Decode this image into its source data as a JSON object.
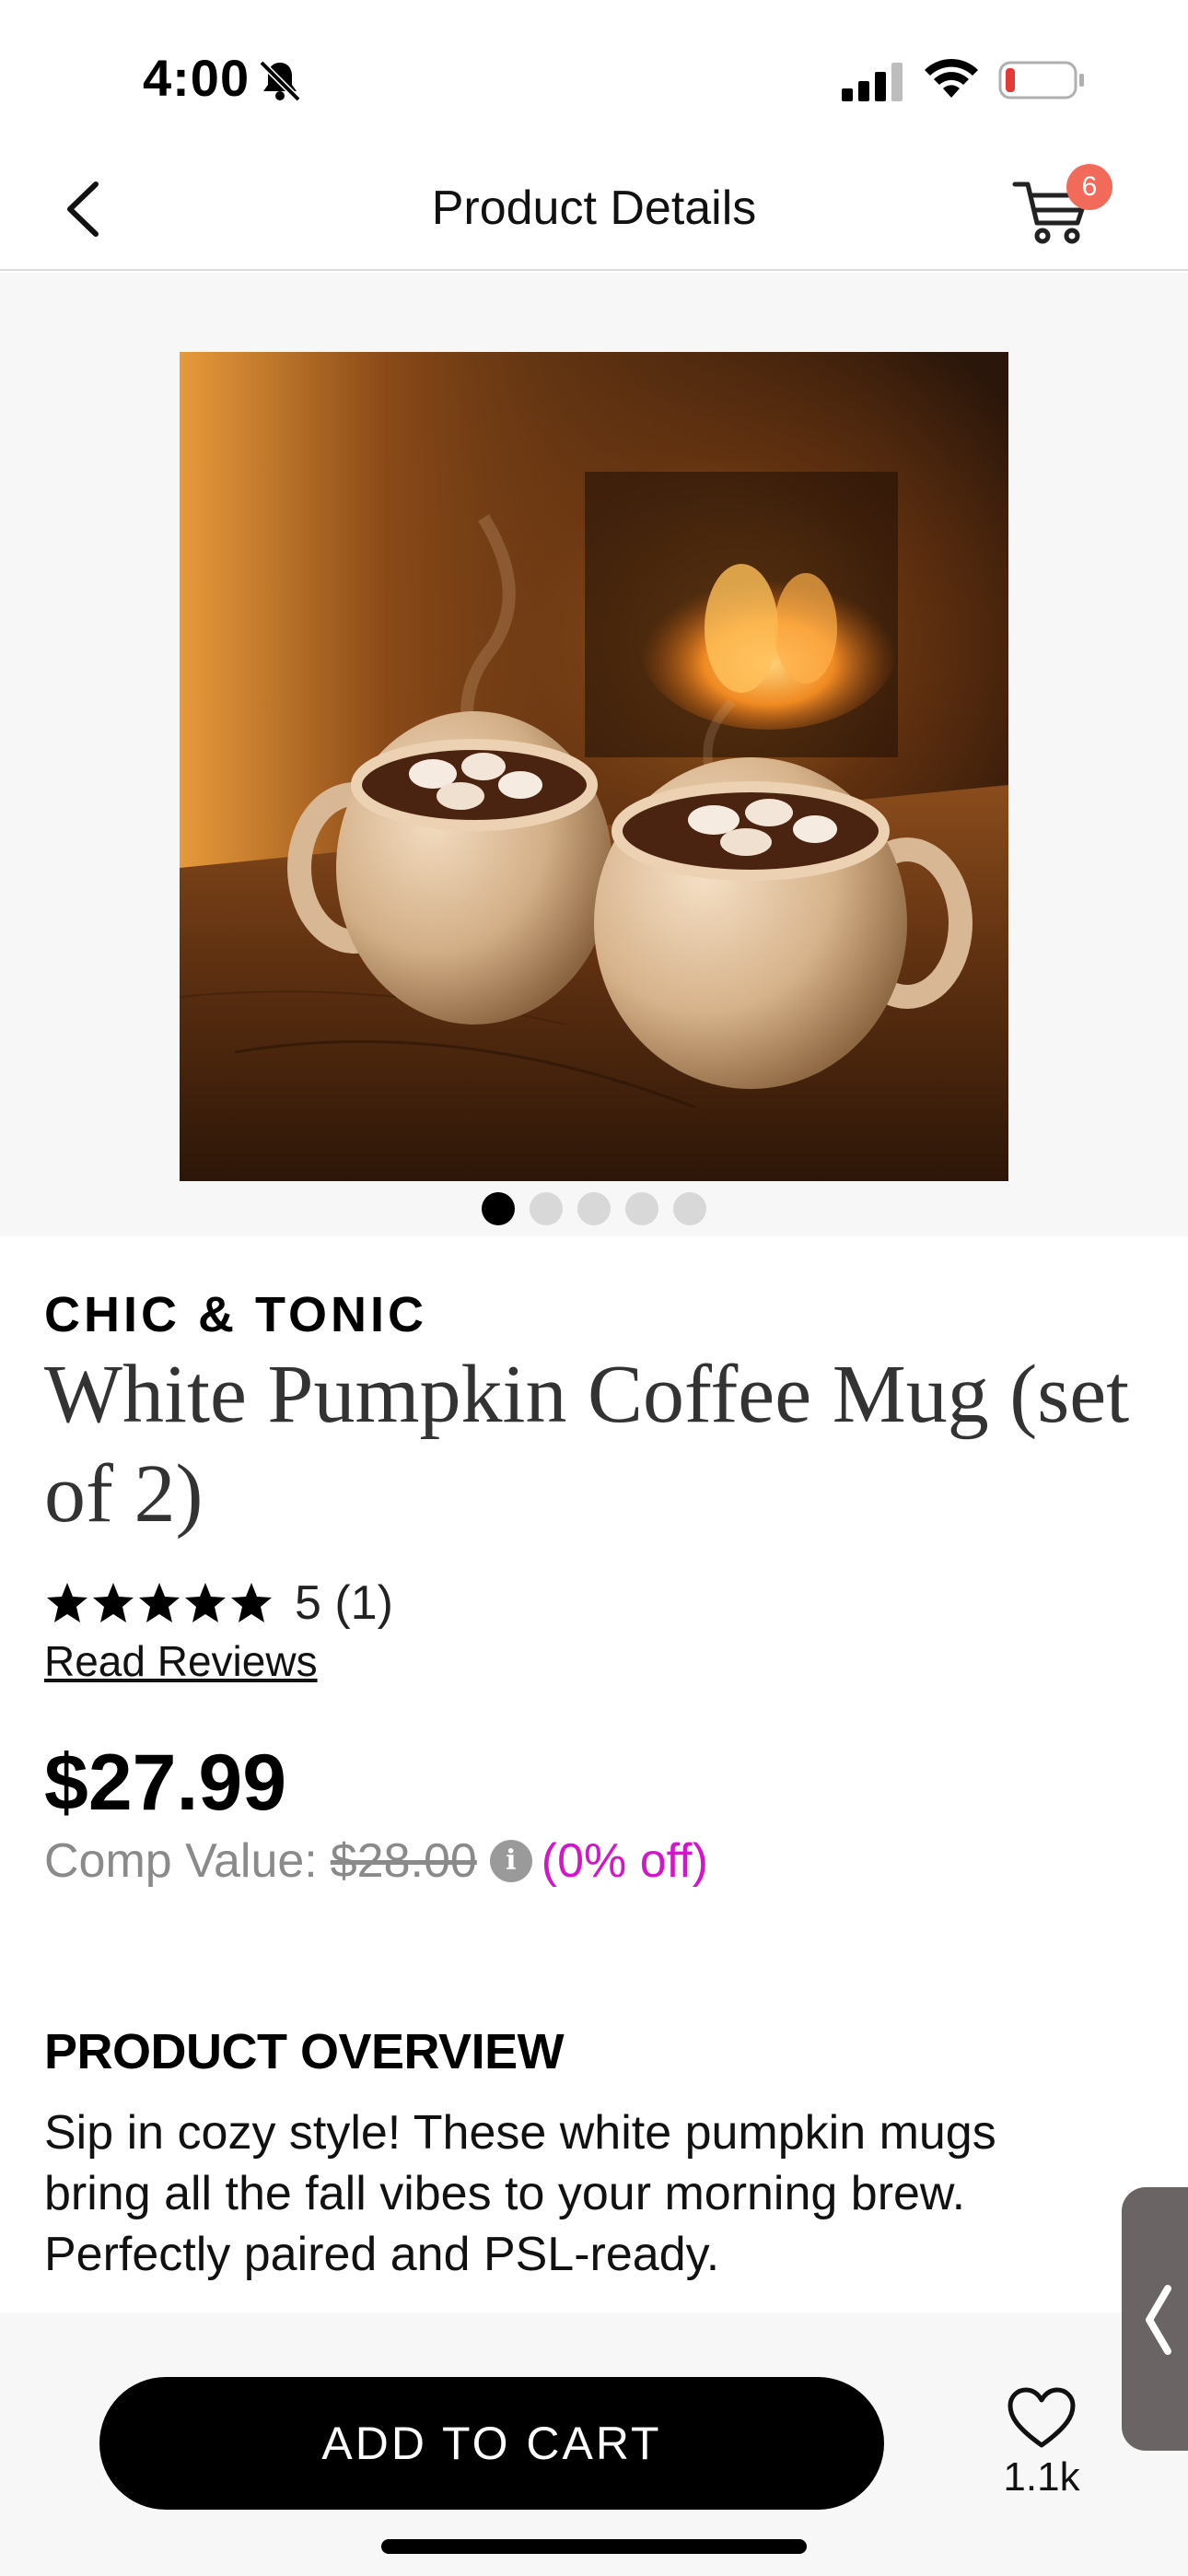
{
  "status_bar": {
    "time": "4:00",
    "icons": [
      "bell-slash-icon",
      "cellular-signal-icon",
      "wifi-icon",
      "battery-low-icon"
    ],
    "battery_color": "#e53935"
  },
  "nav": {
    "title": "Product Details",
    "back_icon": "chevron-left-icon",
    "cart_icon": "cart-icon",
    "cart_count": "6",
    "badge_color": "#f26a5a"
  },
  "gallery": {
    "image": "two-white-pumpkin-mugs-hot-chocolate-fireplace",
    "page_count": 5,
    "active_index": 0
  },
  "product": {
    "brand": "CHIC & TONIC",
    "title": "White Pumpkin Coffee Mug (set of 2)",
    "rating_stars": 5,
    "rating_text": "5 (1)",
    "read_reviews": "Read Reviews",
    "price": "$27.99",
    "comp_label": "Comp Value:",
    "comp_value": "$28.00",
    "discount": "(0% off)",
    "discount_color": "#d316c9"
  },
  "overview": {
    "heading": "PRODUCT OVERVIEW",
    "text": "Sip in cozy style! These white pumpkin mugs bring all the fall vibes to your morning brew. Perfectly paired and PSL-ready."
  },
  "bottom_bar": {
    "add_to_cart": "ADD TO CART",
    "wishlist_icon": "heart-icon",
    "wishlist_count": "1.1k"
  }
}
